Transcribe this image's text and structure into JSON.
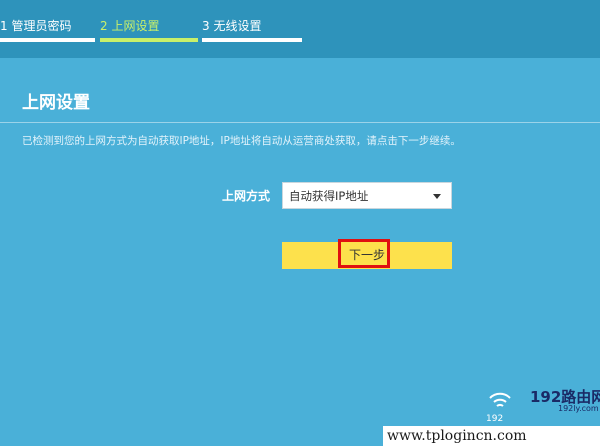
{
  "wizard": {
    "steps": [
      {
        "label": "1 管理员密码",
        "active": false
      },
      {
        "label": "2 上网设置",
        "active": true
      },
      {
        "label": "3 无线设置",
        "active": false
      }
    ],
    "accent_color": "#c8f06a"
  },
  "page": {
    "title": "上网设置",
    "description": "已检测到您的上网方式为自动获取IP地址，IP地址将自动从运营商处获取，请点击下一步继续。"
  },
  "form": {
    "connection_type": {
      "label": "上网方式",
      "selected": "自动获得IP地址"
    },
    "next_button": {
      "label": "下一步",
      "color": "#fde14c",
      "highlight_color": "#e01010"
    }
  },
  "watermark": {
    "logo": "192路由网",
    "subdomain": "192ly.com",
    "number": "192",
    "url": "www.tplogincn.com"
  },
  "colors": {
    "background": "#4ab0d8",
    "topbar": "#2e93bb"
  }
}
